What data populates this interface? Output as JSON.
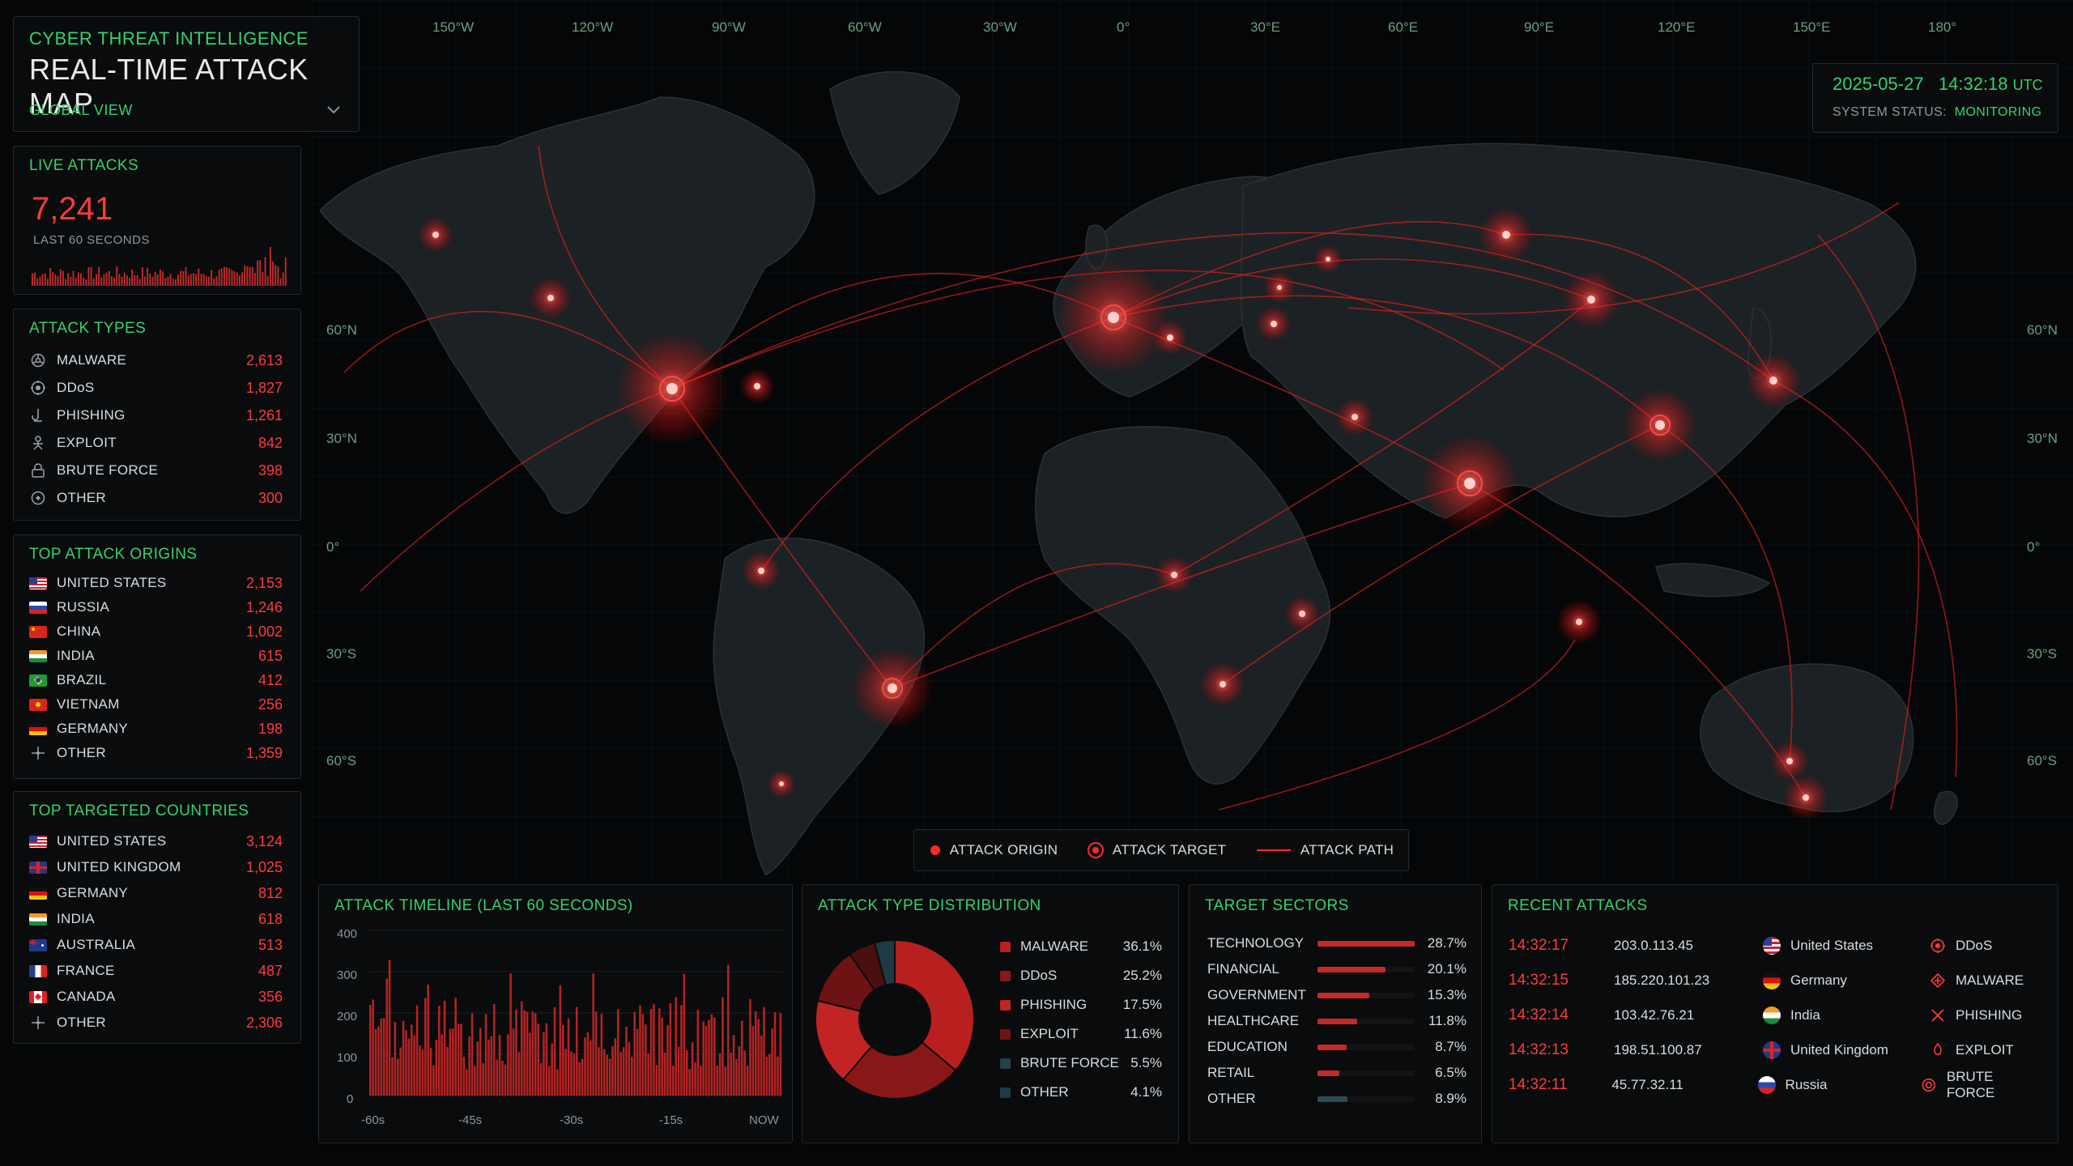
{
  "header": {
    "subtitle": "CYBER THREAT INTELLIGENCE",
    "title": "REAL-TIME ATTACK MAP",
    "view_label": "GLOBAL VIEW"
  },
  "live": {
    "title": "LIVE ATTACKS",
    "count": "7,241",
    "caption": "LAST 60 SECONDS"
  },
  "attack_types": {
    "title": "ATTACK TYPES",
    "items": [
      {
        "label": "MALWARE",
        "value": "2,613",
        "icon": "biohazard-icon"
      },
      {
        "label": "DDoS",
        "value": "1,827",
        "icon": "ddos-icon"
      },
      {
        "label": "PHISHING",
        "value": "1,261",
        "icon": "hook-icon"
      },
      {
        "label": "EXPLOIT",
        "value": "842",
        "icon": "exploit-icon"
      },
      {
        "label": "BRUTE FORCE",
        "value": "398",
        "icon": "brute-force-icon"
      },
      {
        "label": "OTHER",
        "value": "300",
        "icon": "other-icon"
      }
    ]
  },
  "origins": {
    "title": "TOP ATTACK ORIGINS",
    "items": [
      {
        "label": "UNITED STATES",
        "value": "2,153"
      },
      {
        "label": "RUSSIA",
        "value": "1,246"
      },
      {
        "label": "CHINA",
        "value": "1,002"
      },
      {
        "label": "INDIA",
        "value": "615"
      },
      {
        "label": "BRAZIL",
        "value": "412"
      },
      {
        "label": "VIETNAM",
        "value": "256"
      },
      {
        "label": "GERMANY",
        "value": "198"
      },
      {
        "label": "OTHER",
        "value": "1,359"
      }
    ]
  },
  "targets": {
    "title": "TOP TARGETED COUNTRIES",
    "items": [
      {
        "label": "UNITED STATES",
        "value": "3,124"
      },
      {
        "label": "UNITED KINGDOM",
        "value": "1,025"
      },
      {
        "label": "GERMANY",
        "value": "812"
      },
      {
        "label": "INDIA",
        "value": "618"
      },
      {
        "label": "AUSTRALIA",
        "value": "513"
      },
      {
        "label": "FRANCE",
        "value": "487"
      },
      {
        "label": "CANADA",
        "value": "356"
      },
      {
        "label": "OTHER",
        "value": "2,306"
      }
    ]
  },
  "map": {
    "longitudes": [
      "150°W",
      "120°W",
      "90°W",
      "60°W",
      "30°W",
      "0°",
      "30°E",
      "60°E",
      "90°E",
      "120°E",
      "150°E",
      "180°"
    ],
    "latitudes": [
      "60°N",
      "30°N",
      "0°",
      "30°S",
      "60°S"
    ],
    "legend": {
      "origin": "ATTACK ORIGIN",
      "target": "ATTACK TARGET",
      "path": "ATTACK PATH"
    }
  },
  "clock": {
    "date": "2025-05-27",
    "time": "14:32:18",
    "tz": "UTC",
    "status_label": "SYSTEM STATUS:",
    "status_value": "MONITORING"
  },
  "timeline": {
    "title": "ATTACK TIMELINE (LAST 60 SECONDS)",
    "y_ticks": [
      "400",
      "300",
      "200",
      "100",
      "0"
    ],
    "x_ticks": [
      "-60s",
      "-45s",
      "-30s",
      "-15s",
      "NOW"
    ]
  },
  "type_distribution": {
    "title": "ATTACK TYPE DISTRIBUTION",
    "items": [
      {
        "label": "MALWARE",
        "pct": "36.1%",
        "value": 36.1,
        "color": "#b81f1f"
      },
      {
        "label": "DDoS",
        "pct": "25.2%",
        "value": 25.2,
        "color": "#8a1717"
      },
      {
        "label": "PHISHING",
        "pct": "17.5%",
        "value": 17.5,
        "color": "#c22424"
      },
      {
        "label": "EXPLOIT",
        "pct": "11.6%",
        "value": 11.6,
        "color": "#6e1313"
      },
      {
        "label": "BRUTE FORCE",
        "pct": "5.5%",
        "value": 5.5,
        "color": "#4a1010"
      },
      {
        "label": "OTHER",
        "pct": "4.1%",
        "value": 4.1,
        "color": "#1e3a42"
      }
    ]
  },
  "sectors": {
    "title": "TARGET SECTORS",
    "items": [
      {
        "label": "TECHNOLOGY",
        "pct": "28.7%",
        "value": 28.7
      },
      {
        "label": "FINANCIAL",
        "pct": "20.1%",
        "value": 20.1
      },
      {
        "label": "GOVERNMENT",
        "pct": "15.3%",
        "value": 15.3
      },
      {
        "label": "HEALTHCARE",
        "pct": "11.8%",
        "value": 11.8
      },
      {
        "label": "EDUCATION",
        "pct": "8.7%",
        "value": 8.7
      },
      {
        "label": "RETAIL",
        "pct": "6.5%",
        "value": 6.5
      },
      {
        "label": "OTHER",
        "pct": "8.9%",
        "value": 8.9
      }
    ]
  },
  "recent": {
    "title": "RECENT ATTACKS",
    "items": [
      {
        "time": "14:32:17",
        "ip": "203.0.113.45",
        "country": "United States",
        "type": "DDoS"
      },
      {
        "time": "14:32:15",
        "ip": "185.220.101.23",
        "country": "Germany",
        "type": "MALWARE"
      },
      {
        "time": "14:32:14",
        "ip": "103.42.76.21",
        "country": "India",
        "type": "PHISHING"
      },
      {
        "time": "14:32:13",
        "ip": "198.51.100.87",
        "country": "United Kingdom",
        "type": "EXPLOIT"
      },
      {
        "time": "14:32:11",
        "ip": "45.77.32.11",
        "country": "Russia",
        "type": "BRUTE FORCE"
      }
    ]
  }
}
